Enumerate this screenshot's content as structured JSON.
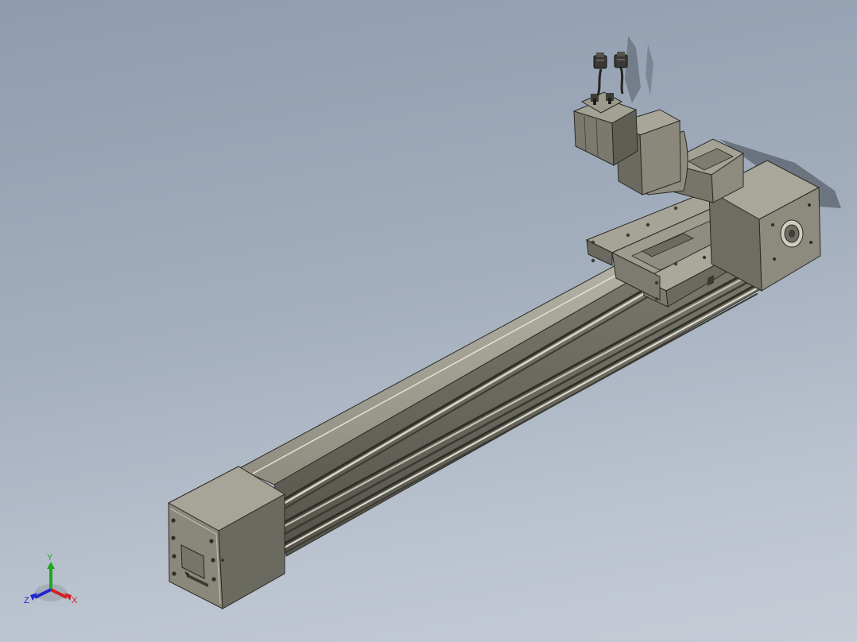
{
  "viewport": {
    "background_top": "#8e9cae",
    "background_bottom": "#c6ccd6"
  },
  "model": {
    "body_color": "#8d8b7e",
    "face_light": "#a9a798",
    "face_dark": "#5f5e55",
    "edge_color": "#2a2a26",
    "motor_color": "#7f7d71"
  },
  "triad": {
    "x_label": "X",
    "y_label": "Y",
    "z_label": "Z",
    "x_color": "#d42020",
    "y_color": "#1fa81f",
    "z_color": "#2424d0"
  }
}
